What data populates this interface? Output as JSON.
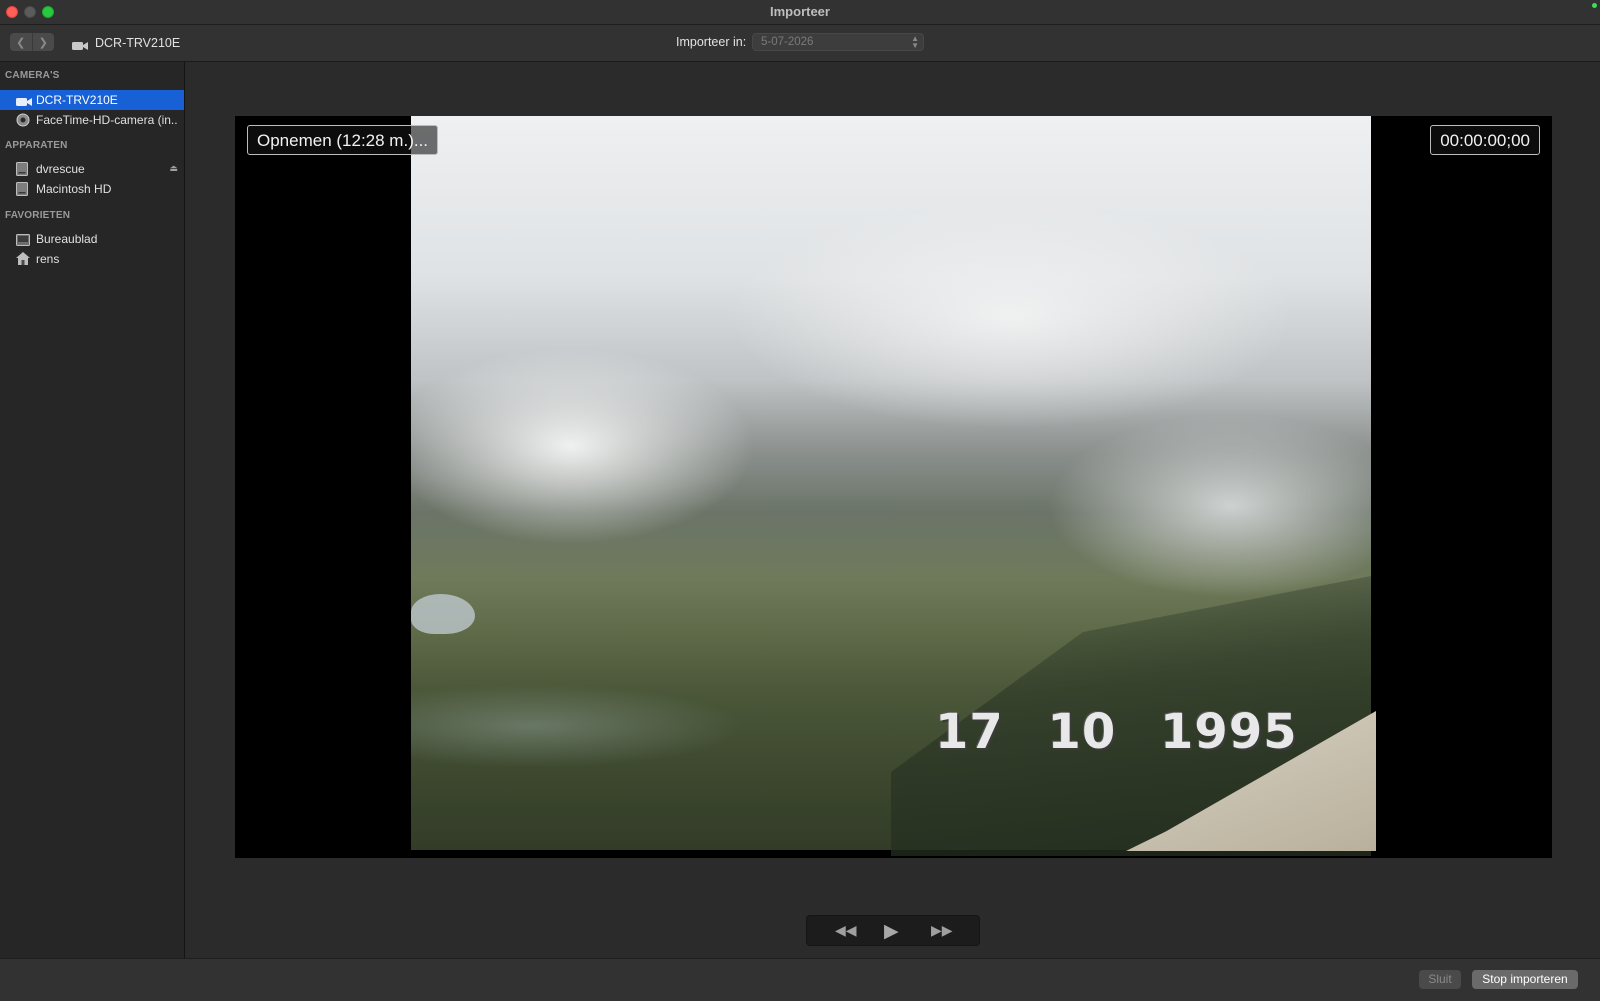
{
  "window": {
    "title": "Importeer"
  },
  "toolbar": {
    "device_name": "DCR-TRV210E",
    "import_label": "Importeer in:",
    "import_value": "5-07-2026",
    "icons": [
      "chevron-left-icon",
      "chevron-right-icon",
      "camcorder-icon"
    ]
  },
  "sidebar": {
    "cameras_header": "CAMERA'S",
    "cameras": [
      {
        "label": "DCR-TRV210E",
        "icon": "camcorder-icon",
        "selected": true
      },
      {
        "label": "FaceTime-HD-camera (in...",
        "icon": "webcam-icon",
        "selected": false
      }
    ],
    "devices_header": "APPARATEN",
    "devices": [
      {
        "label": "dvrescue",
        "icon": "disk-icon",
        "ejectable": true
      },
      {
        "label": "Macintosh HD",
        "icon": "disk-icon",
        "ejectable": false
      }
    ],
    "favorites_header": "FAVORIETEN",
    "favorites": [
      {
        "label": "Bureaublad",
        "icon": "desktop-icon"
      },
      {
        "label": "rens",
        "icon": "home-icon"
      }
    ]
  },
  "video": {
    "recording_label": "Opnemen (12:28 m.)...",
    "timecode": "00:00:00;00",
    "date_stamp": "17 10 1995"
  },
  "transport": {
    "icons": [
      "rewind-icon",
      "play-icon",
      "fast-forward-icon"
    ]
  },
  "footer": {
    "close_label": "Sluit",
    "stop_label": "Stop importeren"
  },
  "colors": {
    "selection": "#1760d6",
    "background": "#2b2b2b",
    "sidebar": "#262626"
  }
}
